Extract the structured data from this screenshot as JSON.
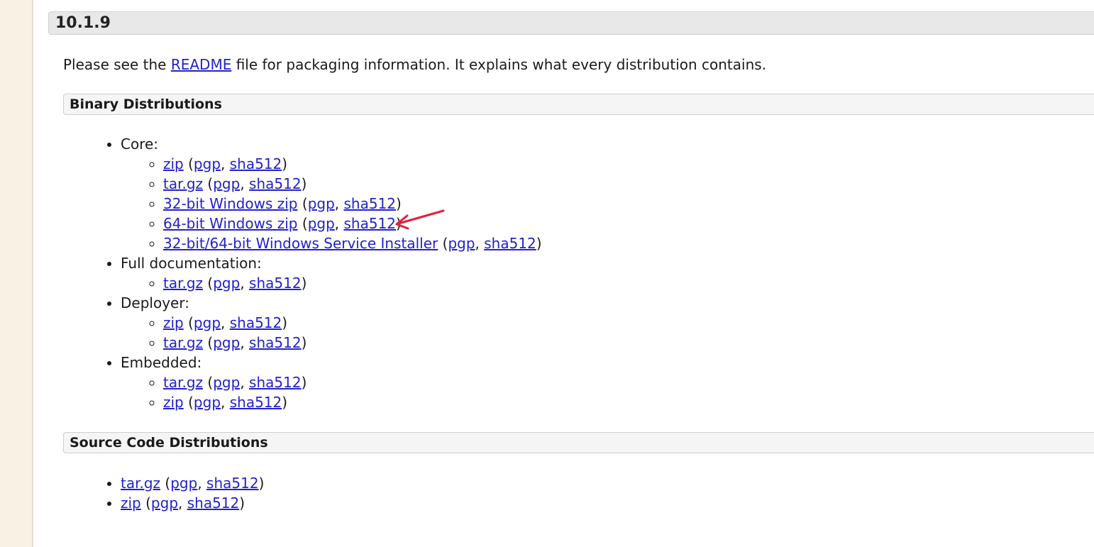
{
  "version": "10.1.9",
  "intro": {
    "before": "Please see the ",
    "link": "README",
    "after": " file for packaging information. It explains what every distribution contains."
  },
  "binary": {
    "title": "Binary Distributions",
    "groups": [
      {
        "label": "Core:",
        "items": [
          {
            "link": "zip",
            "sig": "pgp",
            "hash": "sha512"
          },
          {
            "link": "tar.gz",
            "sig": "pgp",
            "hash": "sha512"
          },
          {
            "link": "32-bit Windows zip",
            "sig": "pgp",
            "hash": "sha512"
          },
          {
            "link": "64-bit Windows zip",
            "sig": "pgp",
            "hash": "sha512"
          },
          {
            "link": "32-bit/64-bit Windows Service Installer",
            "sig": "pgp",
            "hash": "sha512"
          }
        ]
      },
      {
        "label": "Full documentation:",
        "items": [
          {
            "link": "tar.gz",
            "sig": "pgp",
            "hash": "sha512"
          }
        ]
      },
      {
        "label": "Deployer:",
        "items": [
          {
            "link": "zip",
            "sig": "pgp",
            "hash": "sha512"
          },
          {
            "link": "tar.gz",
            "sig": "pgp",
            "hash": "sha512"
          }
        ]
      },
      {
        "label": "Embedded:",
        "items": [
          {
            "link": "tar.gz",
            "sig": "pgp",
            "hash": "sha512"
          },
          {
            "link": "zip",
            "sig": "pgp",
            "hash": "sha512"
          }
        ]
      }
    ]
  },
  "source": {
    "title": "Source Code Distributions",
    "items": [
      {
        "link": "tar.gz",
        "sig": "pgp",
        "hash": "sha512"
      },
      {
        "link": "zip",
        "sig": "pgp",
        "hash": "sha512"
      }
    ]
  },
  "colors": {
    "link": "#2222cc",
    "annotation_arrow": "#e0203a",
    "sidebar": "#f8f1e4"
  },
  "annotation": {
    "icon": "red-arrow-icon",
    "points_to": "64-bit Windows zip"
  }
}
